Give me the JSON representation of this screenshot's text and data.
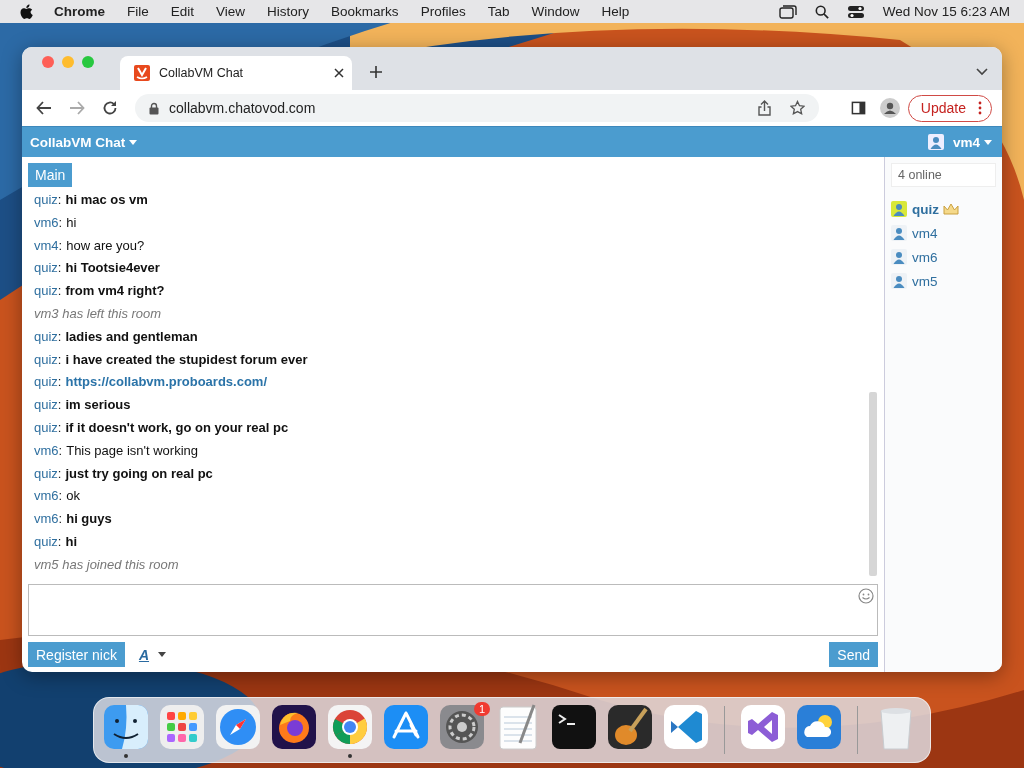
{
  "menubar": {
    "app_name": "Chrome",
    "menus": [
      "File",
      "Edit",
      "View",
      "History",
      "Bookmarks",
      "Profiles",
      "Tab",
      "Window",
      "Help"
    ],
    "clock": "Wed Nov 15 6:23 AM"
  },
  "browser": {
    "tab_title": "CollabVM Chat",
    "url": "collabvm.chatovod.com",
    "update_button": "Update"
  },
  "chat": {
    "title": "CollabVM Chat",
    "user": "vm4",
    "room_tabs": [
      {
        "label": "Main",
        "selected": true
      }
    ],
    "messages": [
      {
        "kind": "chat",
        "user": "quiz",
        "separator": ":",
        "text": "hi mac os vm",
        "bold": true
      },
      {
        "kind": "chat",
        "user": "vm6",
        "separator": ":",
        "text": "hi",
        "bold": false
      },
      {
        "kind": "chat",
        "user": "vm4",
        "separator": ":",
        "text": "how are you?",
        "bold": false
      },
      {
        "kind": "chat",
        "user": "quiz",
        "separator": ":",
        "text": "hi Tootsie4ever",
        "bold": true
      },
      {
        "kind": "chat",
        "user": "quiz",
        "separator": ":",
        "text": "from vm4 right?",
        "bold": true
      },
      {
        "kind": "system",
        "text": "vm3 has left this room"
      },
      {
        "kind": "chat",
        "user": "quiz",
        "separator": ":",
        "text": "ladies and gentleman",
        "bold": true
      },
      {
        "kind": "chat",
        "user": "quiz",
        "separator": ":",
        "text": "i have created the stupidest forum ever",
        "bold": true
      },
      {
        "kind": "link",
        "user": "quiz",
        "separator": ":",
        "text": "https://collabvm.proboards.com/",
        "bold": true
      },
      {
        "kind": "chat",
        "user": "quiz",
        "separator": ":",
        "text": "im serious",
        "bold": true
      },
      {
        "kind": "chat",
        "user": "quiz",
        "separator": ":",
        "text": "if it doesn't work, go on your real pc",
        "bold": true
      },
      {
        "kind": "chat",
        "user": "vm6",
        "separator": ":",
        "text": "This page isn't working",
        "bold": false
      },
      {
        "kind": "chat",
        "user": "quiz",
        "separator": ":",
        "text": "just try going on real pc",
        "bold": true
      },
      {
        "kind": "chat",
        "user": "vm6",
        "separator": ":",
        "text": "ok",
        "bold": false
      },
      {
        "kind": "chat",
        "user": "vm6",
        "separator": ":",
        "text": "hi guys",
        "bold": true
      },
      {
        "kind": "chat",
        "user": "quiz",
        "separator": ":",
        "text": "hi",
        "bold": true
      },
      {
        "kind": "system",
        "text": "vm5 has joined this room"
      }
    ],
    "online_count": "4 online",
    "users": [
      {
        "name": "quiz",
        "admin": true
      },
      {
        "name": "vm4",
        "admin": false
      },
      {
        "name": "vm6",
        "admin": false
      },
      {
        "name": "vm5",
        "admin": false
      }
    ],
    "register_button": "Register nick",
    "font_button": "A",
    "send_button": "Send"
  },
  "dock": [
    {
      "kind": "finder",
      "running": true
    },
    {
      "kind": "launchpad",
      "running": false
    },
    {
      "kind": "safari",
      "running": false
    },
    {
      "kind": "firefox",
      "running": false
    },
    {
      "kind": "chrome",
      "running": true
    },
    {
      "kind": "appstore",
      "running": false
    },
    {
      "kind": "settings",
      "running": false,
      "badge": "1"
    },
    {
      "kind": "textedit",
      "running": false
    },
    {
      "kind": "terminal",
      "running": false
    },
    {
      "kind": "garageband",
      "running": false
    },
    {
      "kind": "vscode",
      "running": false
    },
    {
      "kind": "separator"
    },
    {
      "kind": "visualstudio",
      "running": false
    },
    {
      "kind": "weather",
      "running": false
    },
    {
      "kind": "separator"
    },
    {
      "kind": "trash",
      "running": false
    }
  ]
}
